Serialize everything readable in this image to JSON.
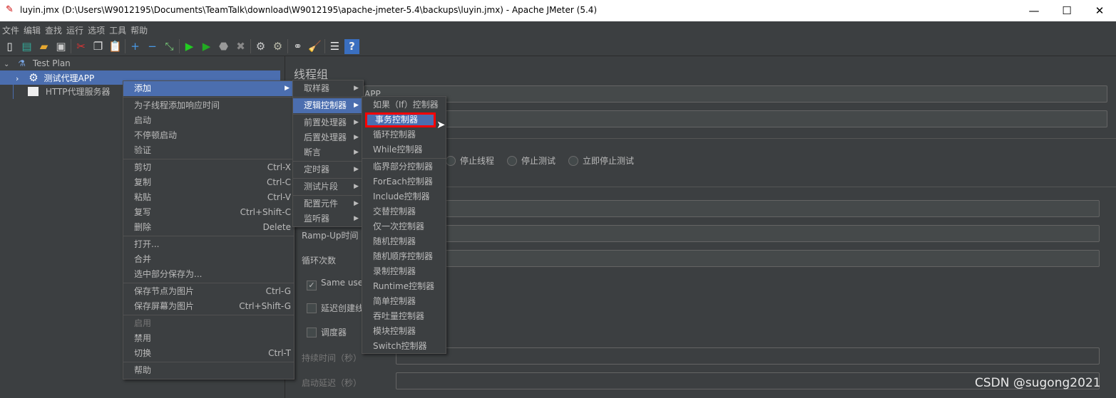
{
  "window": {
    "title": "luyin.jmx (D:\\Users\\W9012195\\Documents\\TeamTalk\\download\\W9012195\\apache-jmeter-5.4\\backups\\luyin.jmx) - Apache JMeter (5.4)",
    "minimize": "—",
    "maximize": "☐",
    "close": "✕"
  },
  "menubar": [
    "文件",
    "编辑",
    "查找",
    "运行",
    "选项",
    "工具",
    "帮助"
  ],
  "toolbar": [
    "new-icon",
    "templates-icon",
    "open-icon",
    "save-icon",
    "cut-icon",
    "copy-icon",
    "paste-icon",
    "expand-icon",
    "collapse-icon",
    "toggle-icon",
    "start-icon",
    "start-no-pause-icon",
    "stop-icon",
    "shutdown-icon",
    "clear-icon",
    "clear-all-icon",
    "search-icon",
    "reset-search-icon",
    "function-helper-icon",
    "help-icon"
  ],
  "tree": {
    "root": "Test Plan",
    "thread_group": "测试代理APP",
    "proxy": "HTTP代理服务器"
  },
  "panel": {
    "title": "线程组",
    "name_value": "APP",
    "radios": [
      "停止线程",
      "停止测试",
      "立即停止测试"
    ],
    "rampup": "Ramp-Up时间（秒）",
    "loops": "循环次数",
    "same_user": "Same user on each iteration",
    "same_user_checked": true,
    "delay_create": "延迟创建线程直到需要",
    "scheduler": "调度器",
    "duration": "持续时间（秒）",
    "startup_delay": "启动延迟（秒）"
  },
  "context_menu": [
    {
      "label": "添加",
      "submenu": true,
      "highlight": true
    },
    {
      "sep": true
    },
    {
      "label": "为子线程添加响应时间"
    },
    {
      "label": "启动"
    },
    {
      "label": "不停顿启动"
    },
    {
      "label": "验证"
    },
    {
      "sep": true
    },
    {
      "label": "剪切",
      "shortcut": "Ctrl-X"
    },
    {
      "label": "复制",
      "shortcut": "Ctrl-C"
    },
    {
      "label": "粘贴",
      "shortcut": "Ctrl-V"
    },
    {
      "label": "复写",
      "shortcut": "Ctrl+Shift-C"
    },
    {
      "label": "删除",
      "shortcut": "Delete"
    },
    {
      "sep": true
    },
    {
      "label": "打开..."
    },
    {
      "label": "合并"
    },
    {
      "label": "选中部分保存为..."
    },
    {
      "sep": true
    },
    {
      "label": "保存节点为图片",
      "shortcut": "Ctrl-G"
    },
    {
      "label": "保存屏幕为图片",
      "shortcut": "Ctrl+Shift-G"
    },
    {
      "sep": true
    },
    {
      "label": "启用",
      "disabled": true
    },
    {
      "label": "禁用"
    },
    {
      "label": "切换",
      "shortcut": "Ctrl-T"
    },
    {
      "sep": true
    },
    {
      "label": "帮助"
    }
  ],
  "add_menu": [
    {
      "label": "取样器",
      "submenu": true
    },
    {
      "sep": true
    },
    {
      "label": "逻辑控制器",
      "submenu": true,
      "highlight": true
    },
    {
      "sep": true
    },
    {
      "label": "前置处理器",
      "submenu": true
    },
    {
      "label": "后置处理器",
      "submenu": true
    },
    {
      "label": "断言",
      "submenu": true
    },
    {
      "sep": true
    },
    {
      "label": "定时器",
      "submenu": true
    },
    {
      "sep": true
    },
    {
      "label": "测试片段",
      "submenu": true
    },
    {
      "sep": true
    },
    {
      "label": "配置元件",
      "submenu": true
    },
    {
      "label": "监听器",
      "submenu": true
    }
  ],
  "logic_menu": [
    {
      "label": "如果（If）控制器"
    },
    {
      "label": "事务控制器",
      "highlight": true,
      "boxed": true
    },
    {
      "label": "循环控制器"
    },
    {
      "label": "While控制器"
    },
    {
      "sep": true
    },
    {
      "label": "临界部分控制器"
    },
    {
      "label": "ForEach控制器"
    },
    {
      "label": "Include控制器"
    },
    {
      "label": "交替控制器"
    },
    {
      "label": "仅一次控制器"
    },
    {
      "label": "随机控制器"
    },
    {
      "label": "随机顺序控制器"
    },
    {
      "label": "录制控制器"
    },
    {
      "label": "Runtime控制器"
    },
    {
      "label": "简单控制器"
    },
    {
      "label": "吞吐量控制器"
    },
    {
      "label": "模块控制器"
    },
    {
      "label": "Switch控制器"
    }
  ],
  "watermark": "CSDN @sugong2021",
  "colors": {
    "selection": "#4b6eaf",
    "highlight_box": "#ff0000",
    "background": "#3c3f41"
  }
}
